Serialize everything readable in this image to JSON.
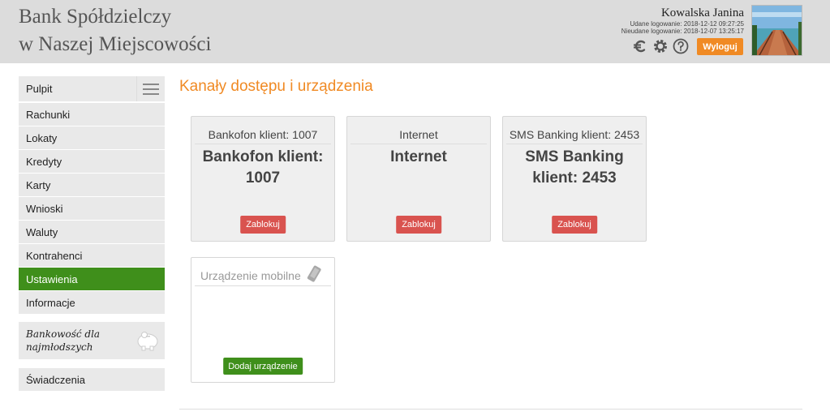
{
  "header": {
    "bank_line1": "Bank Spółdzielczy",
    "bank_line2": "w Naszej Miejscowości",
    "user_name": "Kowalska Janina",
    "last_success_login": "Udane logowanie: 2018-12-12 09:27:25",
    "last_failed_login": "Nieudane logowanie: 2018-12-07 13:25:17",
    "icons": [
      "euro-icon",
      "gear-icon",
      "help-icon"
    ],
    "logout_label": "Wyloguj"
  },
  "sidebar": {
    "items": [
      {
        "label": "Pulpit"
      },
      {
        "label": "Rachunki"
      },
      {
        "label": "Lokaty"
      },
      {
        "label": "Kredyty"
      },
      {
        "label": "Karty"
      },
      {
        "label": "Wnioski"
      },
      {
        "label": "Waluty"
      },
      {
        "label": "Kontrahenci"
      },
      {
        "label": "Ustawienia",
        "active": true
      },
      {
        "label": "Informacje"
      }
    ],
    "kids_label": "Bankowość dla najmłodszych",
    "benefits_label": "Świadczenia"
  },
  "main": {
    "title": "Kanały dostępu i urządzenia",
    "cards": [
      {
        "head": "Bankofon klient: 1007",
        "line1": "Bankofon klient:",
        "line2": "1007",
        "button": "Zablokuj"
      },
      {
        "head": "Internet",
        "line1": "Internet",
        "line2": "",
        "button": "Zablokuj"
      },
      {
        "head": "SMS Banking klient: 2453",
        "line1": "SMS Banking",
        "line2": "klient: 2453",
        "button": "Zablokuj"
      }
    ],
    "mobile": {
      "head": "Urządzenie mobilne",
      "button": "Dodaj urządzenie"
    }
  },
  "colors": {
    "accent_orange": "#f08a24",
    "active_green": "#3f8f1b",
    "block_red": "#d9534f",
    "header_gray": "#dcdcdc"
  }
}
